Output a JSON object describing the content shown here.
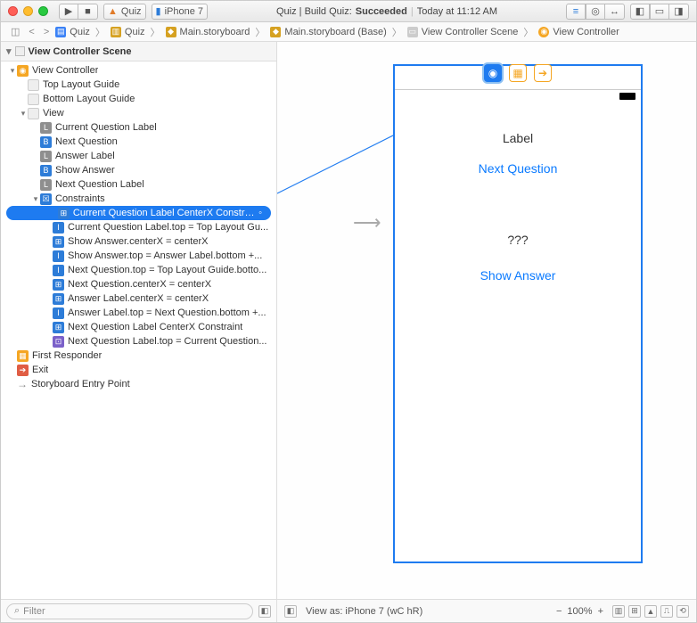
{
  "titlebar": {
    "scheme": "Quiz",
    "device": "iPhone 7",
    "status_prefix": "Quiz | Build Quiz:",
    "status_word": "Succeeded",
    "time": "Today at 11:12 AM"
  },
  "jumpbar": {
    "items": [
      "Quiz",
      "Quiz",
      "Main.storyboard",
      "Main.storyboard (Base)",
      "View Controller Scene",
      "View Controller"
    ]
  },
  "outline": {
    "header": "View Controller Scene",
    "tree": {
      "vc": "View Controller",
      "tlg": "Top Layout Guide",
      "blg": "Bottom Layout Guide",
      "view": "View",
      "cql": "Current Question Label",
      "nq": "Next Question",
      "al": "Answer Label",
      "sa": "Show Answer",
      "nql": "Next Question Label",
      "constraints": "Constraints",
      "c1": "Current Question Label CenterX Constraint",
      "c2": "Current Question Label.top = Top Layout Gu...",
      "c3": "Show Answer.centerX = centerX",
      "c4": "Show Answer.top = Answer Label.bottom +...",
      "c5": "Next Question.top = Top Layout Guide.botto...",
      "c6": "Next Question.centerX = centerX",
      "c7": "Answer Label.centerX = centerX",
      "c8": "Answer Label.top = Next Question.bottom +...",
      "c9": "Next Question Label CenterX Constraint",
      "c10": "Next Question Label.top = Current Question...",
      "fr": "First Responder",
      "exit": "Exit",
      "entry": "Storyboard Entry Point"
    }
  },
  "canvas": {
    "label_text": "Label",
    "next_question": "Next Question",
    "answer_placeholder": "???",
    "show_answer": "Show Answer"
  },
  "statusbar": {
    "filter_placeholder": "Filter",
    "view_as": "View as: iPhone 7 (wC hR)",
    "zoom": "100%"
  }
}
